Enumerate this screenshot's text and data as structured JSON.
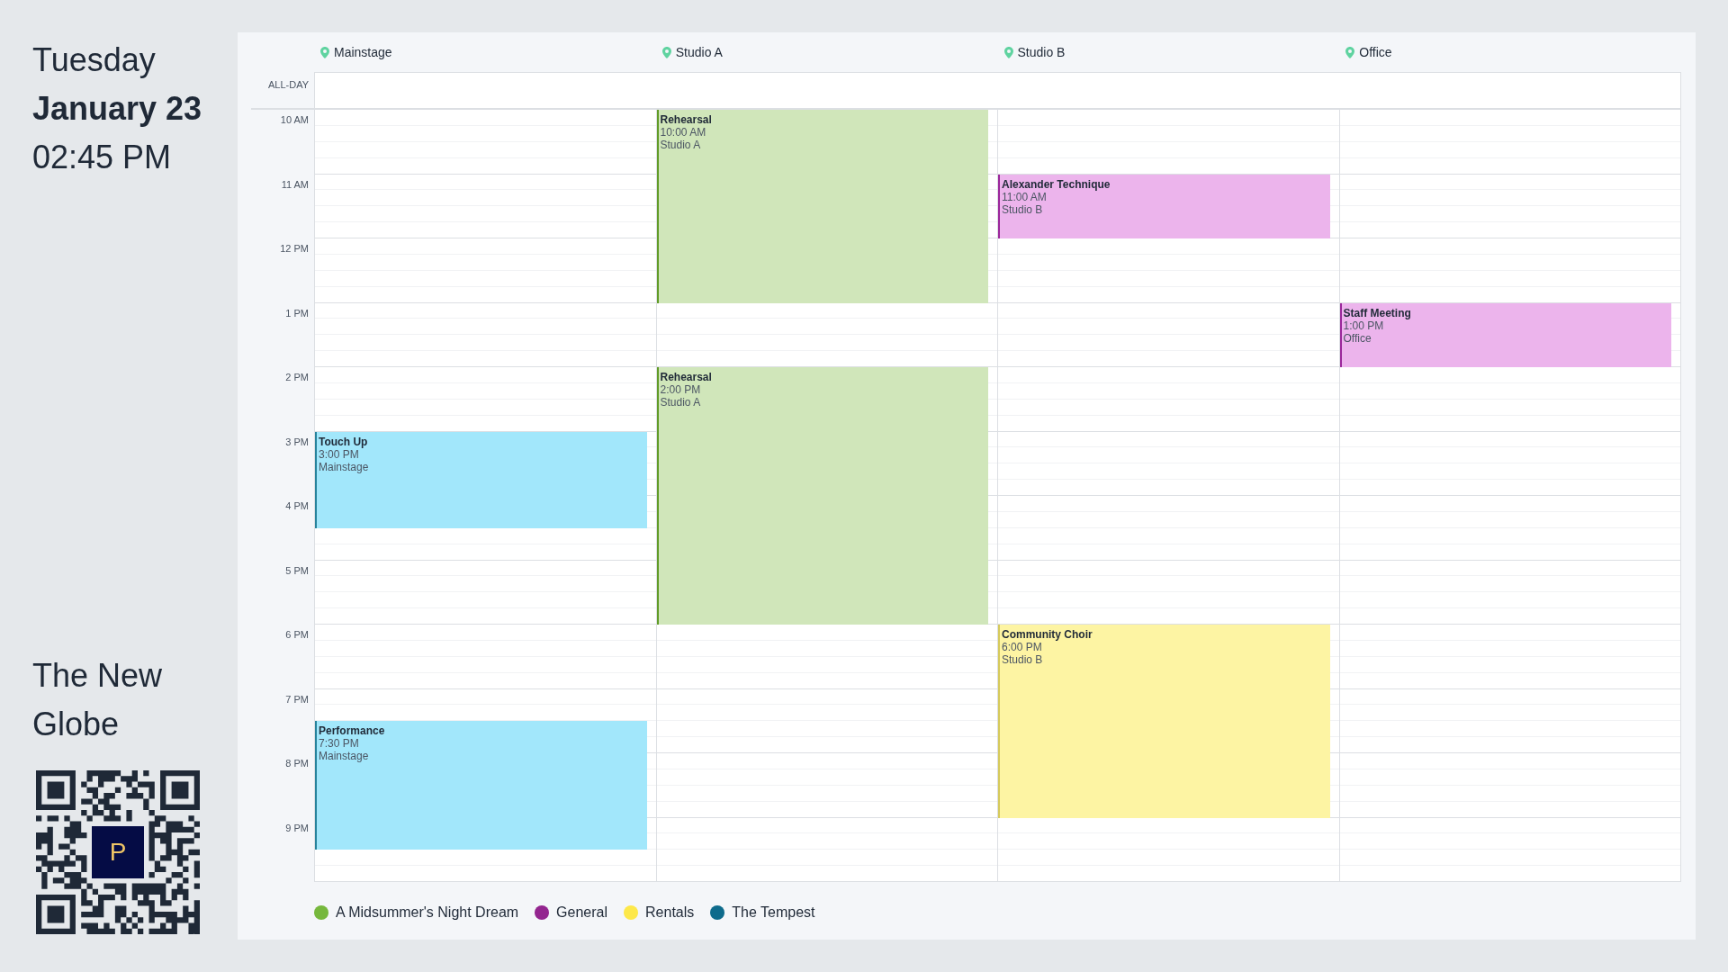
{
  "date": {
    "weekday": "Tuesday",
    "day": "January 23",
    "time": "02:45 PM"
  },
  "venue": "The New Globe",
  "qr": {
    "logo_letter": "P"
  },
  "calendar": {
    "all_day_label": "ALL-DAY",
    "hours": [
      "10 AM",
      "11 AM",
      "12 PM",
      "1 PM",
      "2 PM",
      "3 PM",
      "4 PM",
      "5 PM",
      "6 PM",
      "7 PM",
      "8 PM",
      "9 PM"
    ],
    "columns": [
      {
        "name": "Mainstage",
        "events": [
          {
            "title": "Touch Up",
            "time": "3:00 PM",
            "place": "Mainstage",
            "color": "#a2e7fb"
          },
          {
            "title": "Performance",
            "time": "7:30 PM",
            "place": "Mainstage",
            "color": "#a2e7fb"
          }
        ]
      },
      {
        "name": "Studio A",
        "events": [
          {
            "title": "Rehearsal",
            "time": "10:00 AM",
            "place": "Studio A",
            "color": "#d0e6ba"
          },
          {
            "title": "Rehearsal",
            "time": "2:00 PM",
            "place": "Studio A",
            "color": "#d0e6ba"
          }
        ]
      },
      {
        "name": "Studio B",
        "events": [
          {
            "title": "Alexander Technique",
            "time": "11:00 AM",
            "place": "Studio B",
            "color": "#ecb4ec"
          },
          {
            "title": "Community Choir",
            "time": "6:00 PM",
            "place": "Studio B",
            "color": "#fdf4a3"
          }
        ]
      },
      {
        "name": "Office",
        "events": [
          {
            "title": "Staff Meeting",
            "time": "1:00 PM",
            "place": "Office",
            "color": "#ecb4ec"
          }
        ]
      }
    ]
  },
  "legend": [
    {
      "label": "A Midsummer's Night Dream",
      "color": "#76b83d"
    },
    {
      "label": "General",
      "color": "#93258f"
    },
    {
      "label": "Rentals",
      "color": "#fde84a"
    },
    {
      "label": "The Tempest",
      "color": "#0e6b8c"
    }
  ]
}
